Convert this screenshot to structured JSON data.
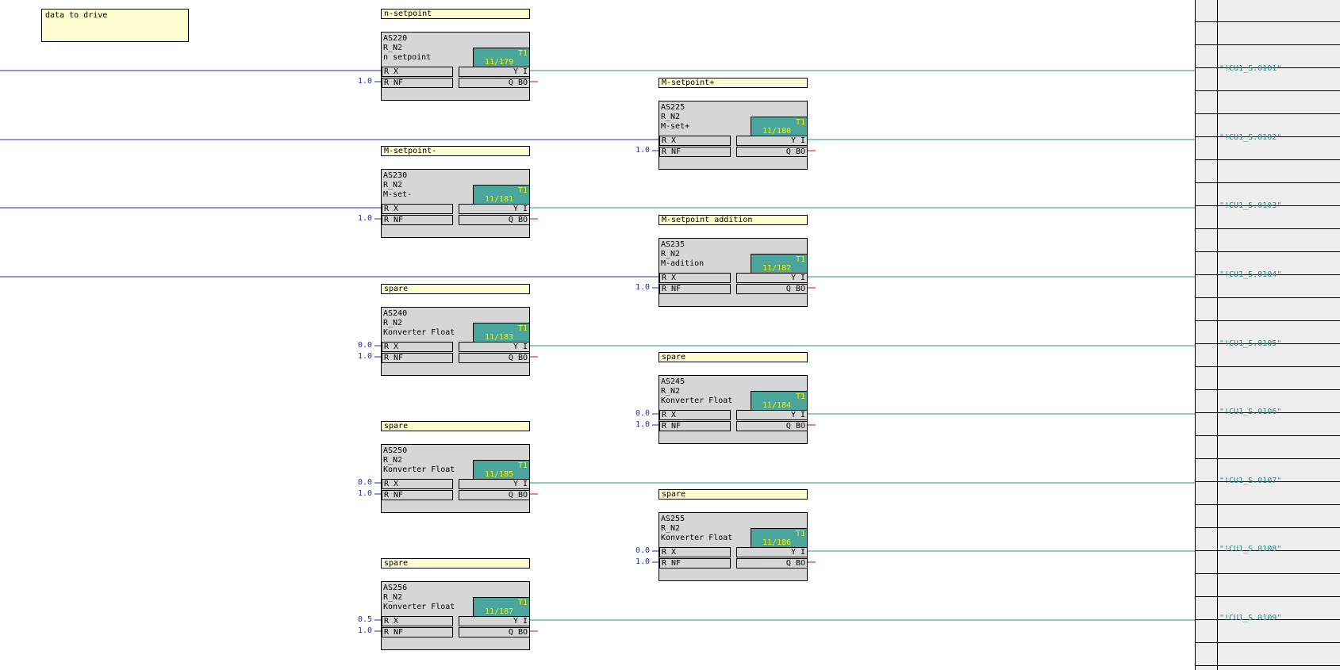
{
  "note": "data to drive",
  "blocks": [
    {
      "label": "n-setpoint",
      "id": "AS220",
      "type": "R_N2",
      "desc": "n setpoint",
      "tl": "T1",
      "tr": "11/179",
      "in_x": "R  X",
      "in_nf": "R  NF",
      "out_y": "Y  I",
      "out_q": "Q BO",
      "const_nf": "1.0"
    },
    {
      "label": "M-setpoint-",
      "id": "AS230",
      "type": "R_N2",
      "desc": "M-set-",
      "tl": "T1",
      "tr": "11/181",
      "in_x": "R  X",
      "in_nf": "R  NF",
      "out_y": "Y  I",
      "out_q": "Q BO",
      "const_nf": "1.0"
    },
    {
      "label": "spare",
      "id": "AS240",
      "type": "R_N2",
      "desc": "Konverter Float",
      "tl": "T1",
      "tr": "11/183",
      "in_x": "R  X",
      "in_nf": "R  NF",
      "out_y": "Y  I",
      "out_q": "Q BO",
      "const_x": "0.0",
      "const_nf": "1.0"
    },
    {
      "label": "spare",
      "id": "AS250",
      "type": "R_N2",
      "desc": "Konverter Float",
      "tl": "T1",
      "tr": "11/185",
      "in_x": "R  X",
      "in_nf": "R  NF",
      "out_y": "Y  I",
      "out_q": "Q BO",
      "const_x": "0.0",
      "const_nf": "1.0"
    },
    {
      "label": "spare",
      "id": "AS256",
      "type": "R_N2",
      "desc": "Konverter Float",
      "tl": "T1",
      "tr": "11/187",
      "in_x": "R  X",
      "in_nf": "R  NF",
      "out_y": "Y  I",
      "out_q": "Q BO",
      "const_x": "0.5",
      "const_nf": "1.0"
    },
    {
      "label": "M-setpoint+",
      "id": "AS225",
      "type": "R_N2",
      "desc": "M-set+",
      "tl": "T1",
      "tr": "11/180",
      "in_x": "R  X",
      "in_nf": "R  NF",
      "out_y": "Y  I",
      "out_q": "Q BO",
      "const_nf": "1.0"
    },
    {
      "label": "M-setpoint addition",
      "id": "AS235",
      "type": "R_N2",
      "desc": "M-adition",
      "tl": "T1",
      "tr": "11/182",
      "in_x": "R  X",
      "in_nf": "R  NF",
      "out_y": "Y  I",
      "out_q": "Q BO",
      "const_nf": "1.0"
    },
    {
      "label": "spare",
      "id": "AS245",
      "type": "R_N2",
      "desc": "Konverter Float",
      "tl": "T1",
      "tr": "11/184",
      "in_x": "R  X",
      "in_nf": "R  NF",
      "out_y": "Y  I",
      "out_q": "Q BO",
      "const_x": "0.0",
      "const_nf": "1.0"
    },
    {
      "label": "spare",
      "id": "AS255",
      "type": "R_N2",
      "desc": "Konverter Float",
      "tl": "T1",
      "tr": "11/186",
      "in_x": "R  X",
      "in_nf": "R  NF",
      "out_y": "Y  I",
      "out_q": "Q BO",
      "const_x": "0.0",
      "const_nf": "1.0"
    }
  ],
  "refs": [
    "\"!CU1_S.0101\"",
    "\"!CU1_S.0102\"",
    "\"!CU1_S.0103\"",
    "\"!CU1_S.0104\"",
    "\"!CU1_S.0105\"",
    "\"!CU1_S.0106\"",
    "\"!CU1_S.0107\"",
    "\"!CU1_S.0108\"",
    "\"!CU1_S.0109\""
  ],
  "colors": {
    "wire_in": "#1a2fb2",
    "wire_out": "#2d8a84",
    "block_bg": "#d6d6d6",
    "label_bg": "#fdfbd0",
    "t1_bg": "#4aa59d",
    "t1_text": "#f4f200",
    "q_stub": "#d9001b"
  }
}
